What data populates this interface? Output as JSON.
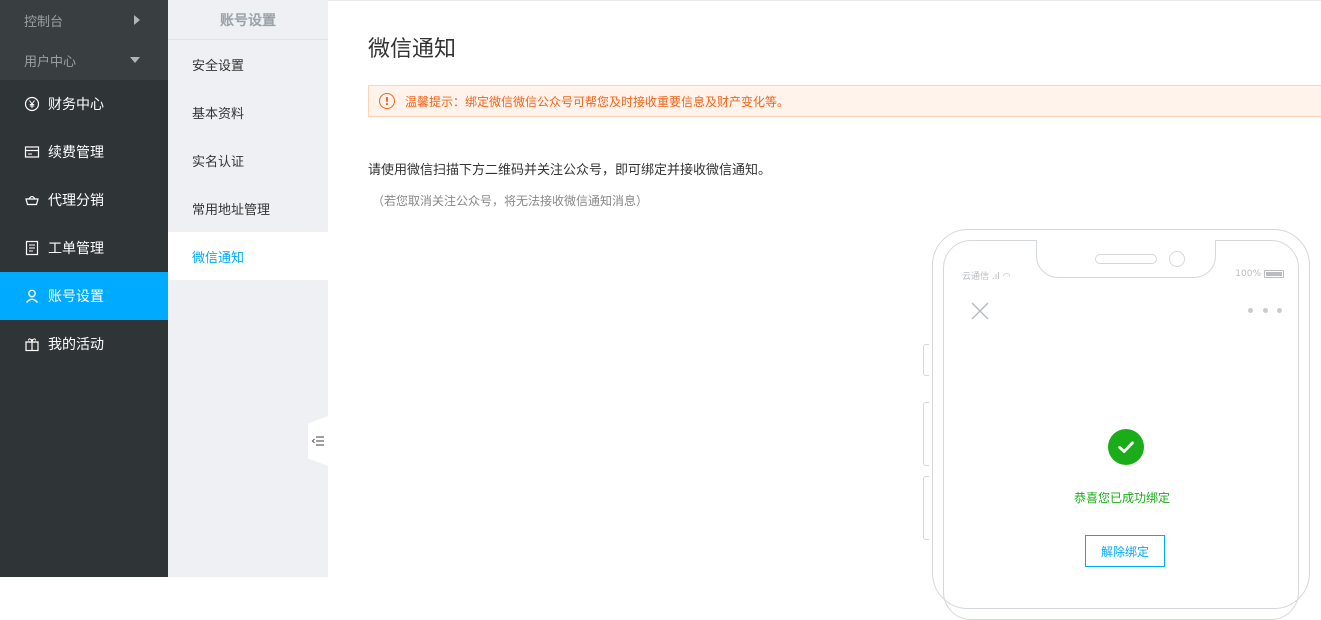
{
  "sidebar": {
    "top_items": [
      {
        "label": "控制台",
        "icon": "caret-right-icon"
      },
      {
        "label": "用户中心",
        "icon": "caret-down-icon"
      }
    ],
    "items": [
      {
        "label": "财务中心",
        "icon": "yen-circle-icon"
      },
      {
        "label": "续费管理",
        "icon": "renew-card-icon"
      },
      {
        "label": "代理分销",
        "icon": "basket-icon"
      },
      {
        "label": "工单管理",
        "icon": "ticket-list-icon"
      },
      {
        "label": "账号设置",
        "icon": "user-icon",
        "active": true
      },
      {
        "label": "我的活动",
        "icon": "gift-icon"
      }
    ],
    "active_color": "#00aaff"
  },
  "subnav": {
    "title": "账号设置",
    "items": [
      {
        "label": "安全设置"
      },
      {
        "label": "基本资料"
      },
      {
        "label": "实名认证"
      },
      {
        "label": "常用地址管理"
      },
      {
        "label": "微信通知",
        "active": true
      }
    ]
  },
  "main": {
    "title": "微信通知",
    "notice": "温馨提示：绑定微信微信公众号可帮您及时接收重要信息及财产变化等。",
    "description": "请使用微信扫描下方二维码并关注公众号，即可绑定并接收微信通知。",
    "sub_description": "（若您取消关注公众号，将无法接收微信通知消息）",
    "phone": {
      "status_carrier": "云通信",
      "status_battery": "100%",
      "success_text": "恭喜您已成功绑定",
      "unbind_label": "解除绑定"
    }
  },
  "colors": {
    "notice_text": "#f2641b",
    "notice_bg": "#fff3ec",
    "success": "#1aad19",
    "accent": "#00aaff"
  }
}
